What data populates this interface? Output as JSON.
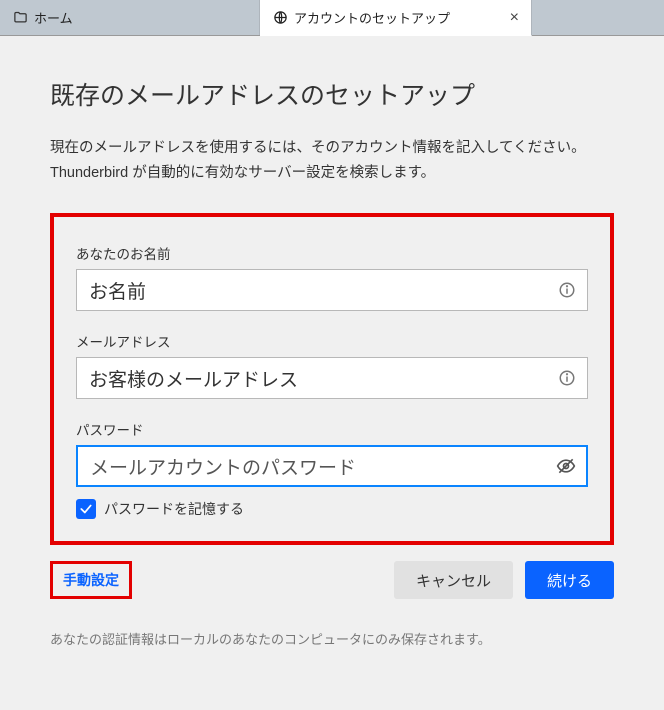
{
  "tabs": {
    "home": {
      "label": "ホーム"
    },
    "setup": {
      "label": "アカウントのセットアップ"
    }
  },
  "page": {
    "heading": "既存のメールアドレスのセットアップ",
    "description": "現在のメールアドレスを使用するには、そのアカウント情報を記入してください。Thunderbird が自動的に有効なサーバー設定を検索します。"
  },
  "form": {
    "name": {
      "label": "あなたのお名前",
      "value": "お名前"
    },
    "email": {
      "label": "メールアドレス",
      "value": "お客様のメールアドレス"
    },
    "password": {
      "label": "パスワード",
      "placeholder": "メールアカウントのパスワード"
    },
    "remember": {
      "label": "パスワードを記憶する",
      "checked": true
    }
  },
  "buttons": {
    "manual": "手動設定",
    "cancel": "キャンセル",
    "continue": "続ける"
  },
  "footer": "あなたの認証情報はローカルのあなたのコンピュータにのみ保存されます。"
}
